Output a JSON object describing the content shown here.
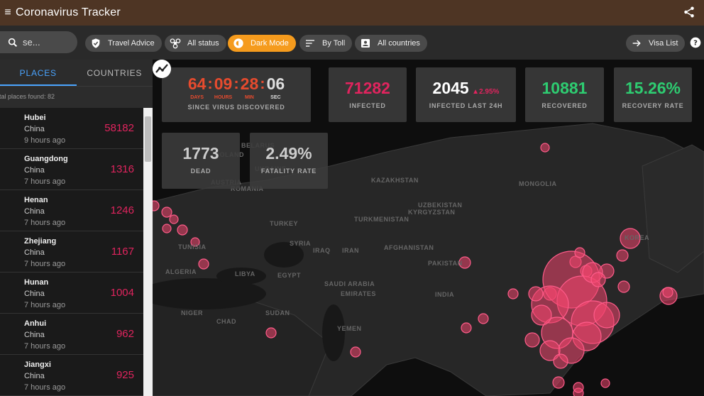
{
  "app": {
    "title": "Coronavirus Tracker"
  },
  "search": {
    "placeholder": "se..."
  },
  "chips": [
    {
      "label": "Travel Advice",
      "icon": "shield-check-icon"
    },
    {
      "label": "All status",
      "icon": "biohazard-icon"
    },
    {
      "label": "Dark Mode",
      "icon": "brightness-icon"
    },
    {
      "label": "By Toll",
      "icon": "sort-icon"
    },
    {
      "label": "All countries",
      "icon": "account-box-icon"
    },
    {
      "label": "Visa List",
      "icon": "arrow-right-icon"
    }
  ],
  "sidebar": {
    "tabs": [
      "PLACES",
      "COUNTRIES"
    ],
    "found_text": "otal places found: 82",
    "rows": [
      {
        "place": "Hubei",
        "country": "China",
        "time": "9 hours ago",
        "count": "58182"
      },
      {
        "place": "Guangdong",
        "country": "China",
        "time": "7 hours ago",
        "count": "1316"
      },
      {
        "place": "Henan",
        "country": "China",
        "time": "7 hours ago",
        "count": "1246"
      },
      {
        "place": "Zhejiang",
        "country": "China",
        "time": "7 hours ago",
        "count": "1167"
      },
      {
        "place": "Hunan",
        "country": "China",
        "time": "7 hours ago",
        "count": "1004"
      },
      {
        "place": "Anhui",
        "country": "China",
        "time": "7 hours ago",
        "count": "962"
      },
      {
        "place": "Jiangxi",
        "country": "China",
        "time": "7 hours ago",
        "count": "925"
      }
    ]
  },
  "timer": {
    "days": "64",
    "hours": "09",
    "min": "28",
    "sec": "06",
    "days_label": "DAYS",
    "hours_label": "HOURS",
    "min_label": "MIN",
    "sec_label": "SEC",
    "caption": "SINCE VIRUS DISCOVERED"
  },
  "stats": {
    "infected": {
      "value": "71282",
      "label": "INFECTED"
    },
    "infected24": {
      "value": "2045",
      "delta": "▲2.95%",
      "label": "INFECTED LAST 24H"
    },
    "recovered": {
      "value": "10881",
      "label": "RECOVERED"
    },
    "recovery_rate": {
      "value": "15.26%",
      "label": "RECOVERY RATE"
    },
    "dead": {
      "value": "1773",
      "label": "DEAD"
    },
    "fatality_rate": {
      "value": "2.49%",
      "label": "FATALITY RATE"
    }
  },
  "map_labels": [
    "POLAND",
    "BELARUS",
    "UKRAINE",
    "AUSTRIA",
    "ROMANIA",
    "KAZAKHSTAN",
    "MONGOLIA",
    "UZBEKISTAN",
    "KYRGYZSTAN",
    "TURKMENISTAN",
    "TURKEY",
    "TUNISIA",
    "SYRIA",
    "IRAQ",
    "IRAN",
    "AFGHANISTAN",
    "PAKISTAN",
    "ALGERIA",
    "LIBYA",
    "EGYPT",
    "SAUDI ARABIA",
    "EMIRATES",
    "INDIA",
    "NIGER",
    "CHAD",
    "SUDAN",
    "YEMEN",
    "KOREA"
  ],
  "colors": {
    "appbar": "#4e3524",
    "accent": "#f59b1d",
    "infected": "#e0245e",
    "recovered": "#2ecc71",
    "timer": "#e74b2e",
    "tab": "#4aa4ff"
  }
}
